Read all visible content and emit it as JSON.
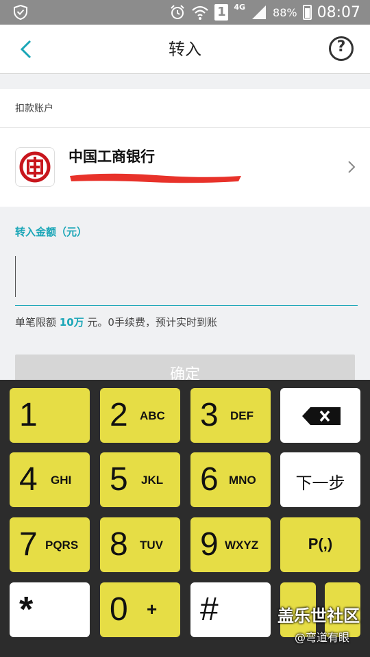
{
  "status_bar": {
    "signal_type": "4G",
    "sim_slot": "1",
    "battery": "88%",
    "time": "08:07",
    "icons": [
      "shield-icon",
      "alarm-icon",
      "wifi-icon",
      "sim-1-icon",
      "cell-signal-icon",
      "battery-icon"
    ]
  },
  "header": {
    "title": "转入",
    "help_label": "?"
  },
  "debit_account": {
    "section_label": "扣款账户",
    "bank_name": "中国工商银行",
    "logo_label": "ICBC logo"
  },
  "amount": {
    "label": "转入金额（元）",
    "value": "",
    "limit_prefix": "单笔限额 ",
    "limit_amount": "10万",
    "limit_suffix": " 元。0手续费，预计实时到账"
  },
  "confirm_button": "确定",
  "keypad": {
    "keys": [
      {
        "digit": "1",
        "letters": ""
      },
      {
        "digit": "2",
        "letters": "ABC"
      },
      {
        "digit": "3",
        "letters": "DEF"
      },
      {
        "digit": "4",
        "letters": "GHI"
      },
      {
        "digit": "5",
        "letters": "JKL"
      },
      {
        "digit": "6",
        "letters": "MNO"
      },
      {
        "digit": "7",
        "letters": "PQRS"
      },
      {
        "digit": "8",
        "letters": "TUV"
      },
      {
        "digit": "9",
        "letters": "WXYZ"
      },
      {
        "digit": "*",
        "letters": ""
      },
      {
        "digit": "0",
        "letters": "+"
      },
      {
        "digit": "#",
        "letters": ""
      }
    ],
    "next_label": "下一步",
    "pause_label": "P(,)"
  },
  "watermark": {
    "line1": "盖乐世社区",
    "line2": "@弯道有眼"
  },
  "colors": {
    "accent": "#1aa6b7",
    "key_yellow": "#e6dd45",
    "keypad_bg": "#2c2c2c",
    "redaction": "#e8322a"
  }
}
